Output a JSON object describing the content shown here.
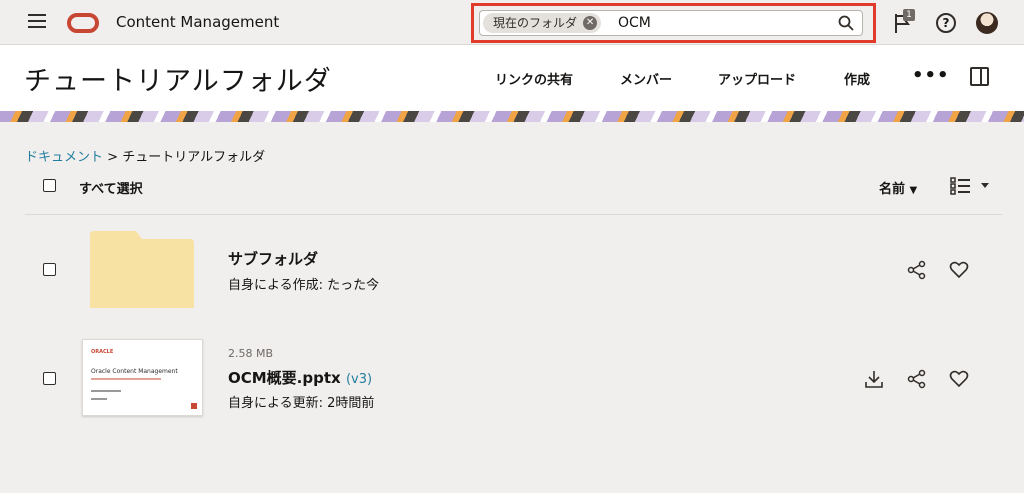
{
  "app": {
    "title": "Content Management"
  },
  "search": {
    "scope_chip": "現在のフォルダ",
    "query": "OCM"
  },
  "notifications": {
    "count": "1"
  },
  "header": {
    "title": "チュートリアルフォルダ",
    "actions": [
      "リンクの共有",
      "メンバー",
      "アップロード",
      "作成"
    ]
  },
  "breadcrumb": {
    "root": "ドキュメント",
    "separator": ">",
    "current": "チュートリアルフォルダ"
  },
  "toolbar": {
    "select_all_label": "すべて選択",
    "sort_label": "名前"
  },
  "items": [
    {
      "name": "サブフォルダ",
      "meta": "自身による作成: たった今",
      "type": "folder"
    },
    {
      "name": "OCM概要.pptx",
      "version": "(v3)",
      "size": "2.58 MB",
      "meta": "自身による更新: 2時間前",
      "type": "file"
    }
  ],
  "thumbnail": {
    "brand": "ORACLE",
    "title": "Oracle Content Management"
  },
  "colors": {
    "accent": "#c74634",
    "link": "#227e9e",
    "highlight": "#e13b2c",
    "folder": "#f7e2a4"
  }
}
